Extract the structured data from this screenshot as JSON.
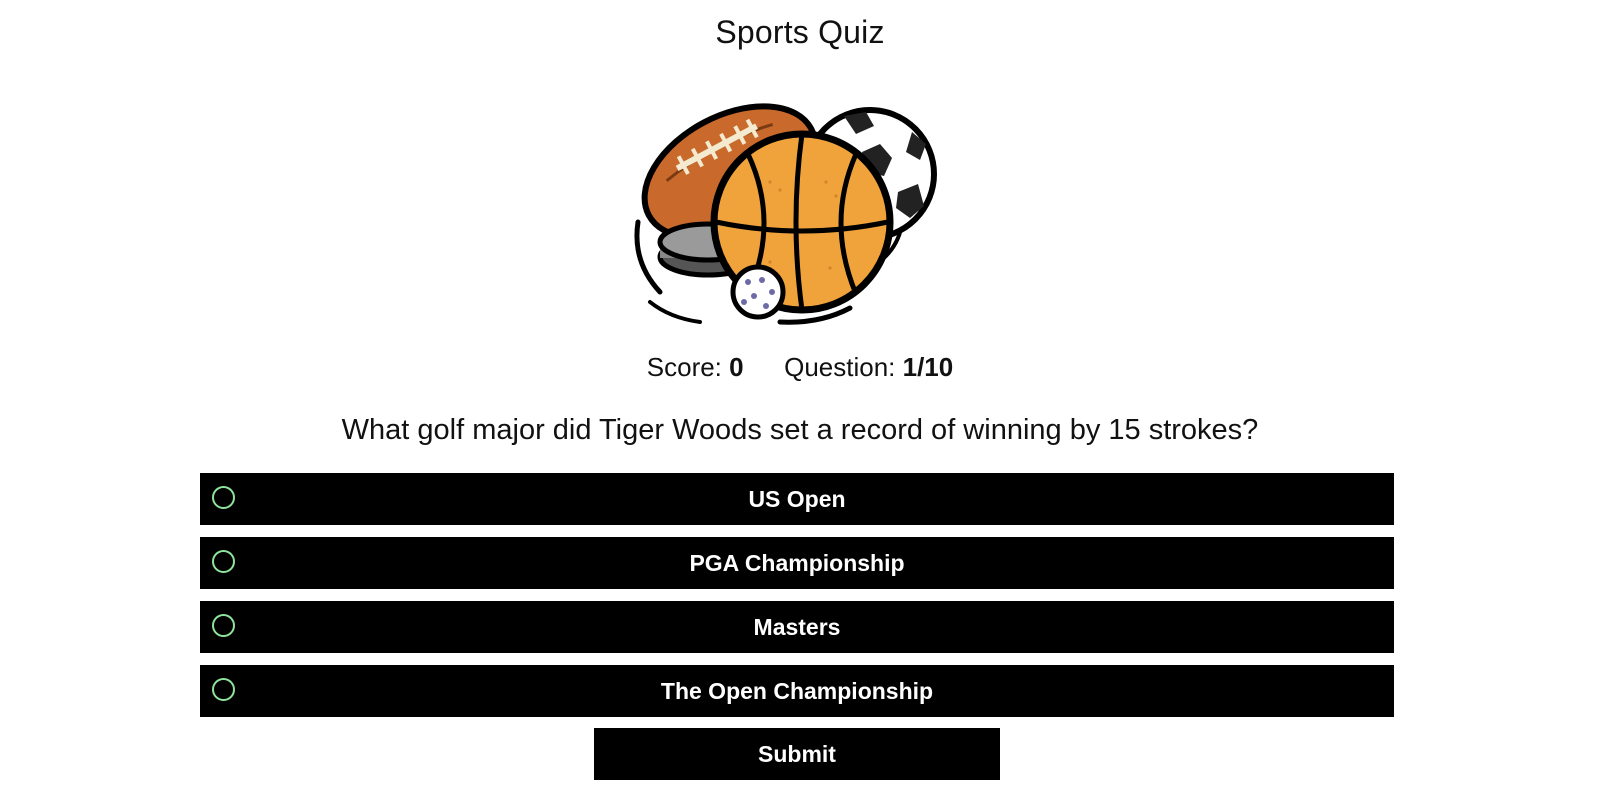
{
  "quiz": {
    "title": "Sports Quiz",
    "logo_icon": "sports-balls-icon"
  },
  "status": {
    "score_label": "Score:",
    "score_value": "0",
    "question_label": "Question:",
    "question_value": "1/10"
  },
  "question": {
    "text": "What golf major did Tiger Woods set a record of winning by 15 strokes?",
    "answers": [
      {
        "label": "US Open",
        "selected": false
      },
      {
        "label": "PGA Championship",
        "selected": false
      },
      {
        "label": "Masters",
        "selected": false
      },
      {
        "label": "The Open Championship",
        "selected": false
      }
    ]
  },
  "actions": {
    "submit_label": "Submit"
  },
  "colors": {
    "button_background": "#000000",
    "button_text": "#ffffff",
    "radio_outline": "#8fe39a",
    "basketball": "#f0a33a",
    "football": "#c96a2c"
  }
}
